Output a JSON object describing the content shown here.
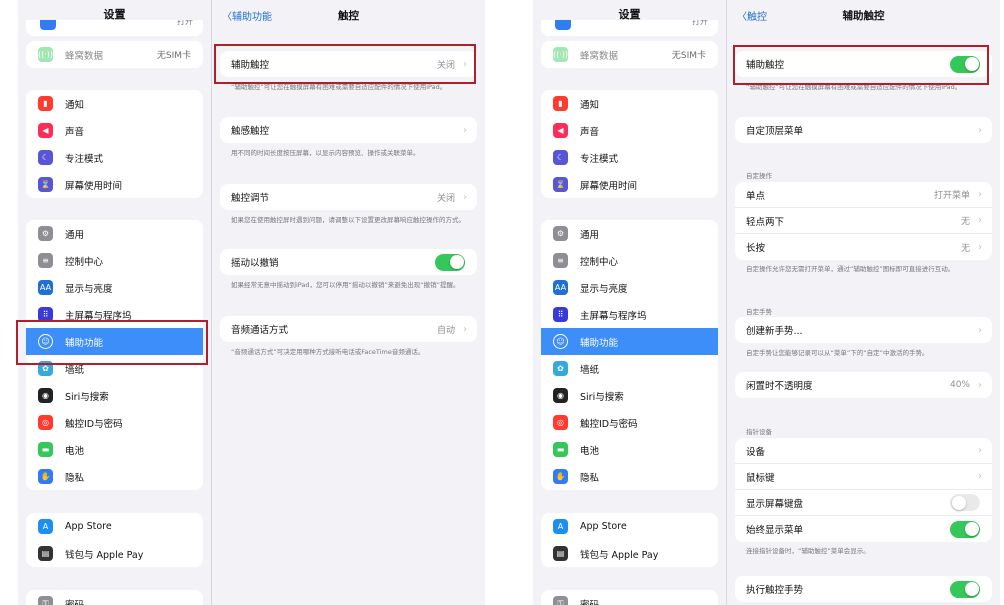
{
  "left": {
    "sidebar": {
      "title": "设置",
      "top_partial_value": "打开",
      "cellular": {
        "label": "蜂窝数据",
        "value": "无SIM卡"
      },
      "group1": [
        "通知",
        "声音",
        "专注模式",
        "屏幕使用时间"
      ],
      "group2": [
        "通用",
        "控制中心",
        "显示与亮度",
        "主屏幕与程序坞",
        "辅助功能",
        "墙纸",
        "Siri与搜索",
        "触控ID与密码",
        "电池",
        "隐私"
      ],
      "group3": [
        "App Store",
        "钱包与 Apple Pay"
      ],
      "group4_partial": "密码"
    },
    "nav": {
      "back": "辅助功能",
      "title": "触控"
    },
    "rows": {
      "assistive_touch": {
        "label": "辅助触控",
        "value": "关闭"
      },
      "assistive_touch_note": "“辅助触控”可让您在触摸屏幕有困难或需要自适应配件的情况下使用iPad。",
      "haptic_touch": {
        "label": "触感触控"
      },
      "haptic_touch_note": "用不同的时间长度按压屏幕，以显示内容预览、操作或关联菜单。",
      "touch_accommodations": {
        "label": "触控调节",
        "value": "关闭"
      },
      "touch_accommodations_note": "如果您在使用触控屏时遇到问题，请调整以下设置更改屏幕响应触控操作的方式。",
      "shake_undo": {
        "label": "摇动以撤销",
        "on": true
      },
      "shake_undo_note": "如果经常无意中摇动到iPad，您可以停用“摇动以撤销”来避免出现“撤销”提醒。",
      "call_audio": {
        "label": "音频通话方式",
        "value": "自动"
      },
      "call_audio_note": "“音频通话方式”可决定用哪种方式接听电话或FaceTime音频通话。"
    }
  },
  "right": {
    "nav": {
      "back": "触控",
      "title": "辅助触控"
    },
    "assistive_touch": {
      "label": "辅助触控",
      "on": true
    },
    "assistive_touch_note": "“辅助触控”可让您在触摸屏幕有困难或需要自适应配件的情况下使用iPad。",
    "customize_top_menu": "自定顶层菜单",
    "custom_actions_header": "自定操作",
    "single_tap": {
      "label": "单点",
      "value": "打开菜单"
    },
    "double_tap": {
      "label": "轻点两下",
      "value": "无"
    },
    "long_press": {
      "label": "长按",
      "value": "无"
    },
    "custom_actions_note": "自定操作允许您无需打开菜单，通过“辅助触控”图标即可直接进行互动。",
    "custom_gestures_header": "自定手势",
    "create_gesture": "创建新手势...",
    "custom_gestures_note": "自定手势让您能够记录可以从“菜单”下的“自定”中激活的手势。",
    "idle_opacity": {
      "label": "闲置时不透明度",
      "value": "40%"
    },
    "pointer_devices_header": "指针设备",
    "devices": "设备",
    "mouse_keys": "鼠标键",
    "show_onscreen_keyboard": {
      "label": "显示屏幕键盘",
      "on": false
    },
    "always_show_menu": {
      "label": "始终显示菜单",
      "on": true
    },
    "always_show_menu_note": "连接指针设备时，“辅助触控”菜单会显示。",
    "perform_touch_gestures": {
      "label": "执行触控手势",
      "on": true
    }
  },
  "colors": {
    "accent": "#3d8ef8",
    "highlight": "#b01f2a",
    "toggle_on": "#34c759"
  }
}
